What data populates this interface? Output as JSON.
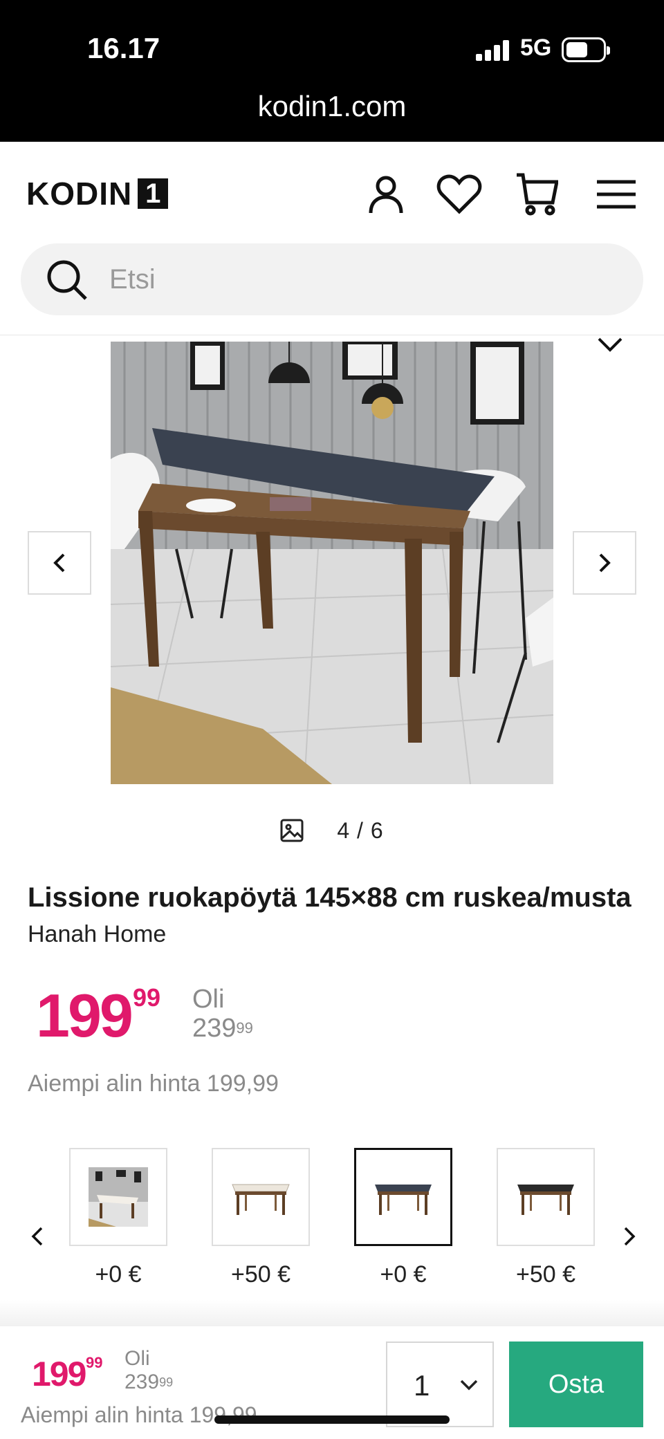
{
  "status_bar": {
    "time": "16.17",
    "network": "5G"
  },
  "browser": {
    "url": "kodin1.com"
  },
  "header": {
    "logo_text": "KODIN",
    "logo_box": "1",
    "search_placeholder": "Etsi"
  },
  "gallery": {
    "counter": "4 / 6"
  },
  "product": {
    "title": "Lissione ruokapöytä 145×88 cm ruskea/musta",
    "brand": "Hanah Home",
    "price_int": "199",
    "price_dec": "99",
    "was_label": "Oli",
    "was_int": "239",
    "was_dec": "99",
    "lowest_price_text": "Aiempi alin hinta 199,99"
  },
  "variants": [
    {
      "price": "+0 €",
      "selected": false,
      "style": "room-photo"
    },
    {
      "price": "+50 €",
      "selected": false,
      "style": "white-top"
    },
    {
      "price": "+0 €",
      "selected": true,
      "style": "dark-top"
    },
    {
      "price": "+50 €",
      "selected": false,
      "style": "black-top"
    }
  ],
  "footer": {
    "price_int": "199",
    "price_dec": "99",
    "was_label": "Oli",
    "was_int": "239",
    "was_dec": "99",
    "lowest_price_text": "Aiempi alin hinta 199,99",
    "quantity": "1",
    "buy_label": "Osta"
  },
  "colors": {
    "price": "#e0196b",
    "buy_button": "#26a97f"
  }
}
